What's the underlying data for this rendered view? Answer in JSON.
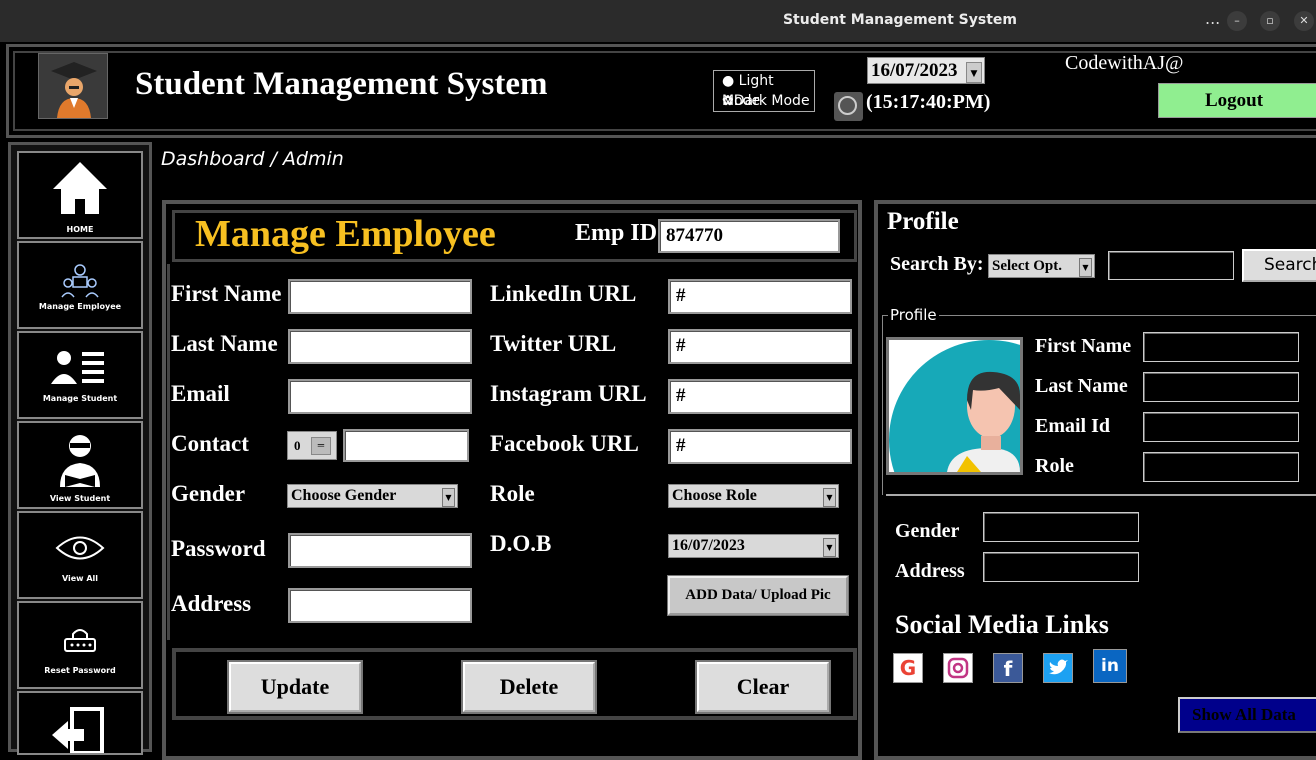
{
  "window": {
    "title": "Student Management System",
    "controls": [
      "...",
      "–",
      "▫",
      "✕"
    ]
  },
  "header": {
    "app_title": "Student Management System",
    "light_mode": "Light Mode",
    "dark_mode": "Dark Mode",
    "date": "16/07/2023",
    "time": "(15:17:40:PM)",
    "user": "CodewithAJ@",
    "logout": "Logout"
  },
  "sidebar": {
    "items": [
      {
        "label": "HOME",
        "icon": "home-icon"
      },
      {
        "label": "Manage Employee",
        "icon": "team-icon"
      },
      {
        "label": "Manage Student",
        "icon": "student-list-icon"
      },
      {
        "label": "View Student",
        "icon": "reader-icon"
      },
      {
        "label": "View All",
        "icon": "eye-icon"
      },
      {
        "label": "Reset Password",
        "icon": "password-icon"
      },
      {
        "label": "",
        "icon": "exit-icon"
      }
    ]
  },
  "breadcrumb": "Dashboard / Admin",
  "manage": {
    "title": "Manage Employee",
    "emp_id_label": "Emp ID",
    "emp_id_value": "874770",
    "labels": {
      "first_name": "First Name",
      "last_name": "Last Name",
      "email": "Email",
      "contact": "Contact",
      "gender": "Gender",
      "password": "Password",
      "address": "Address",
      "linkedin": "LinkedIn URL",
      "twitter": "Twitter URL",
      "instagram": "Instagram URL",
      "facebook": "Facebook URL",
      "role": "Role",
      "dob": "D.O.B"
    },
    "values": {
      "contact_code": "0",
      "linkedin": "#",
      "twitter": "#",
      "instagram": "#",
      "facebook": "#",
      "gender": "Choose Gender",
      "role": "Choose Role",
      "dob": "16/07/2023"
    },
    "upload_button": "ADD Data/ Upload Pic",
    "buttons": {
      "update": "Update",
      "delete": "Delete",
      "clear": "Clear"
    }
  },
  "profile": {
    "title": "Profile",
    "search_by_label": "Search By:",
    "search_option": "Select Opt.",
    "search_button": "Search",
    "frame_label": "Profile",
    "labels": {
      "first_name": "First Name",
      "last_name": "Last Name",
      "email": "Email Id",
      "role": "Role",
      "gender": "Gender",
      "address": "Address"
    },
    "social_title": "Social Media Links",
    "social_icons": [
      "google-icon",
      "instagram-icon",
      "facebook-icon",
      "twitter-icon",
      "linkedin-icon"
    ],
    "show_all": "Show All Data"
  },
  "colors": {
    "accent_title": "#f7c021",
    "logout_bg": "#90ee90",
    "show_all_bg": "#00008b"
  }
}
